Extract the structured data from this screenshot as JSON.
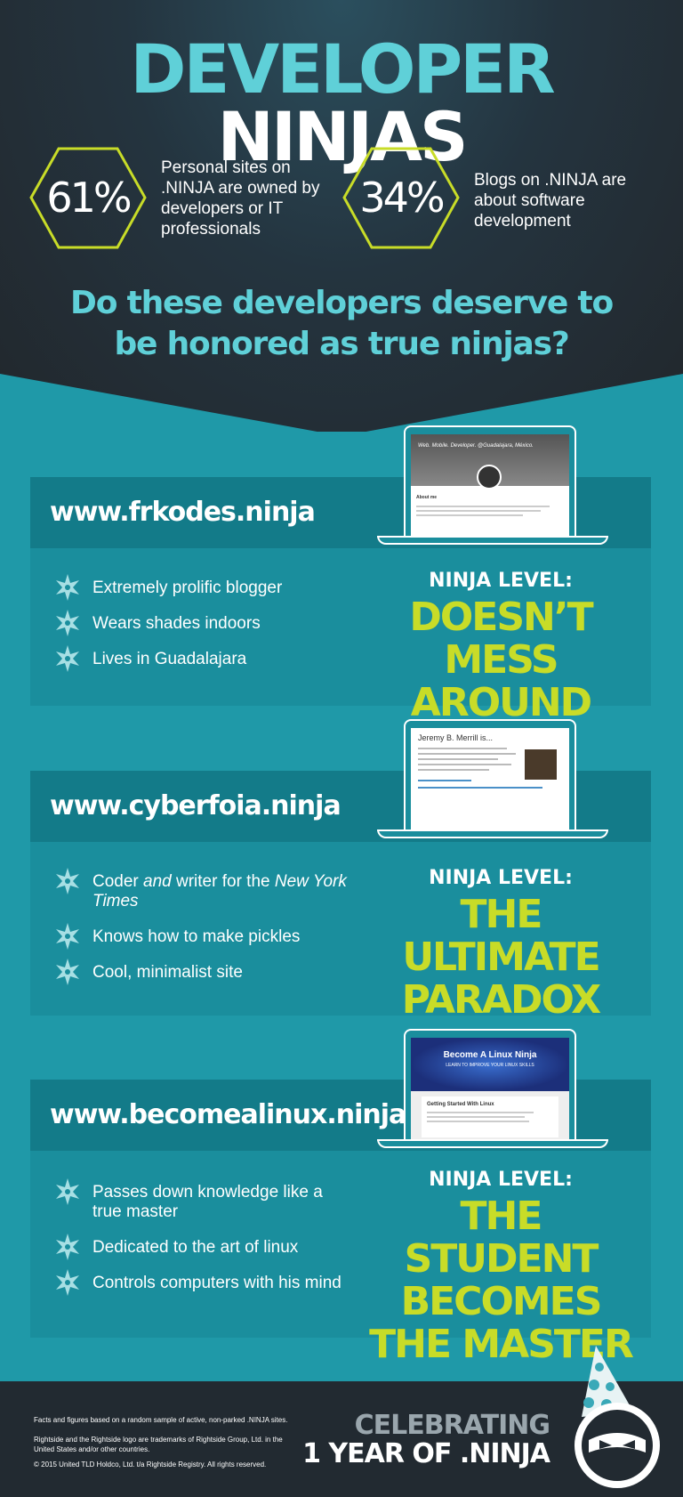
{
  "header": {
    "title_part1": "DEVELOPER",
    "title_part2": "NINJAS",
    "stats": [
      {
        "percent": "61%",
        "description": "Personal sites on .NINJA are owned by developers or IT professionals"
      },
      {
        "percent": "34%",
        "description": "Blogs on .NINJA are about software development"
      }
    ],
    "question": "Do these developers deserve to be honored as true ninjas?"
  },
  "sites": [
    {
      "url": "www.frkodes.ninja",
      "bullets": [
        "Extremely prolific blogger",
        "Wears shades indoors",
        "Lives in Guadalajara"
      ],
      "level_label": "NINJA LEVEL:",
      "level_text": "DOESN’T MESS AROUND",
      "screen_caption": "Web. Mobile. Developer. @Guadalajara, México.",
      "screen_heading": "About me"
    },
    {
      "url": "www.cyberfoia.ninja",
      "bullets_rich": [
        [
          "Coder ",
          "and",
          " writer for the ",
          "New York Times"
        ]
      ],
      "bullets": [
        "Knows how to make pickles",
        "Cool, minimalist site"
      ],
      "level_label": "NINJA LEVEL:",
      "level_text": "THE ULTIMATE PARADOX",
      "screen_heading": "Jeremy B. Merrill is..."
    },
    {
      "url": "www.becomealinux.ninja",
      "bullets": [
        "Passes down knowledge like a true master",
        "Dedicated to the art of linux",
        "Controls computers with his mind"
      ],
      "level_label": "NINJA LEVEL:",
      "level_text": "THE STUDENT BECOMES THE MASTER",
      "screen_title": "Become A Linux Ninja",
      "screen_subtitle": "LEARN TO IMPROVE YOUR LINUX SKILLS",
      "screen_heading": "Getting Started With Linux"
    }
  ],
  "footer": {
    "fine_print": [
      "Facts and figures based on a random sample of active, non-parked .NINJA sites.",
      "Rightside and the Rightside logo are trademarks of Rightside Group, Ltd. in the United States and/or other countries.",
      "© 2015 United TLD Holdco, Ltd. t/a Rightside Registry. All rights reserved."
    ],
    "celebrate_line1": "CELEBRATING",
    "celebrate_line2": "1 YEAR OF .NINJA"
  },
  "colors": {
    "accent_cyan": "#5fd0d8",
    "accent_lime": "#c8dc28",
    "teal_dark": "#137b89",
    "teal": "#1a8e9d",
    "navy": "#222a31"
  }
}
